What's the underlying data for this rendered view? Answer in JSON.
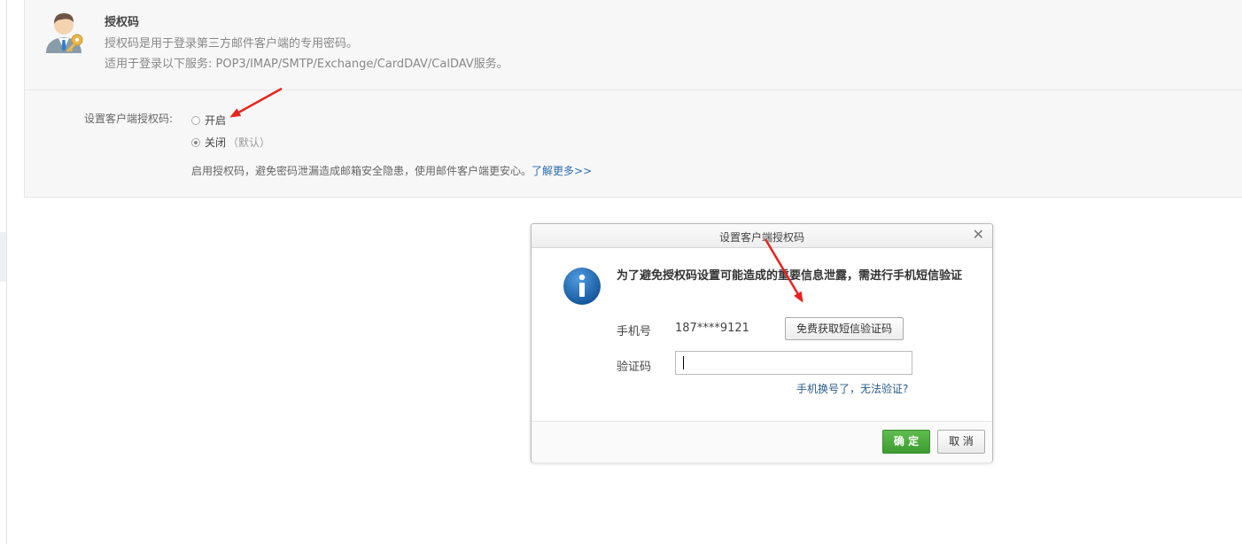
{
  "header": {
    "title": "授权码",
    "desc1": "授权码是用于登录第三方邮件客户端的专用密码。",
    "desc2": "适用于登录以下服务: POP3/IMAP/SMTP/Exchange/CardDAV/CalDAV服务。",
    "icon": "user-key-icon"
  },
  "setting": {
    "label": "设置客户端授权码:",
    "option_on": "开启",
    "option_off": "关闭",
    "option_off_suffix": "（默认）",
    "selected": "关闭",
    "hint": "启用授权码，避免密码泄漏造成邮箱安全隐患，使用邮件客户端更安心。",
    "learn_more": "了解更多>>"
  },
  "dialog": {
    "title": "设置客户端授权码",
    "close_icon": "close-icon",
    "info_icon": "info-icon",
    "message": "为了避免授权码设置可能造成的重要信息泄露，需进行手机短信验证",
    "phone_label": "手机号",
    "phone_value": "187****9121",
    "sms_button": "免费获取短信验证码",
    "code_label": "验证码",
    "code_value": "",
    "cant_verify": "手机换号了，无法验证?",
    "ok": "确 定",
    "cancel": "取 消"
  },
  "colors": {
    "annotation_arrow": "#e8231e",
    "ok_button": "#4caf3e",
    "link": "#2b6cb0",
    "info_icon": "#1d6fbf"
  }
}
